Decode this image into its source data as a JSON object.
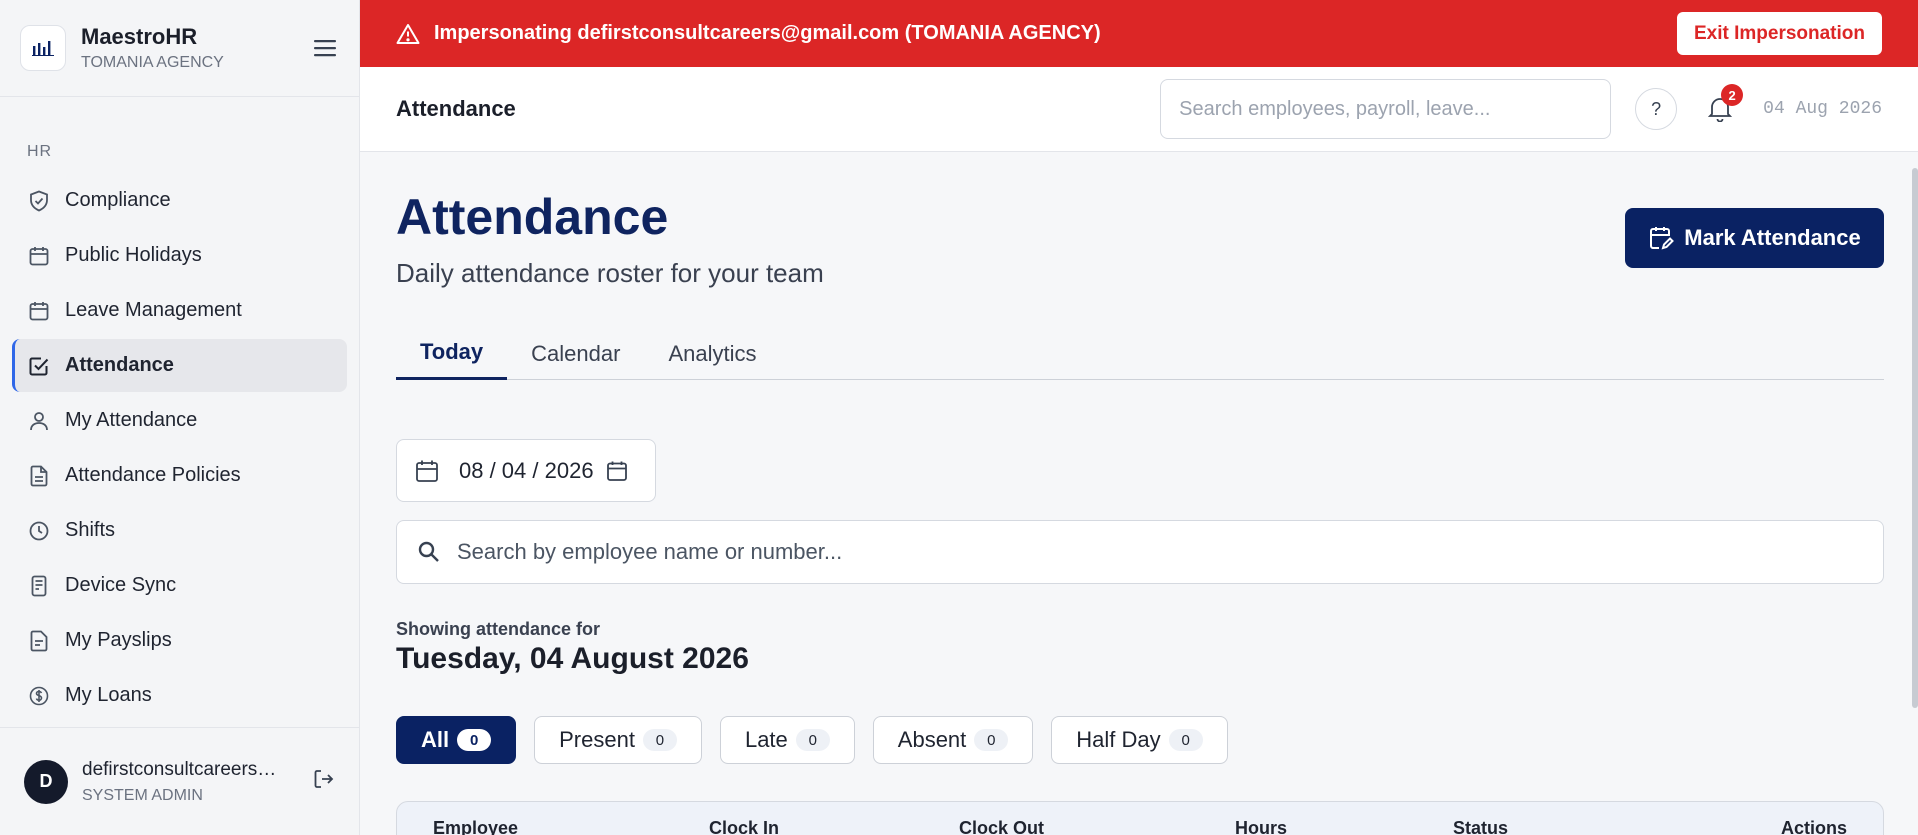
{
  "sidebar": {
    "brand_name": "MaestroHR",
    "brand_org": "TOMANIA AGENCY",
    "section_label": "HR",
    "items": [
      {
        "label": "Compliance",
        "icon": "shield-check-icon"
      },
      {
        "label": "Public Holidays",
        "icon": "calendar-icon"
      },
      {
        "label": "Leave Management",
        "icon": "calendar-icon"
      },
      {
        "label": "Attendance",
        "icon": "checkbox-icon",
        "active": true
      },
      {
        "label": "My Attendance",
        "icon": "user-icon"
      },
      {
        "label": "Attendance Policies",
        "icon": "document-icon"
      },
      {
        "label": "Shifts",
        "icon": "clock-icon"
      },
      {
        "label": "Device Sync",
        "icon": "device-icon"
      },
      {
        "label": "My Payslips",
        "icon": "receipt-icon"
      },
      {
        "label": "My Loans",
        "icon": "dollar-circle-icon"
      }
    ],
    "user": {
      "initial": "D",
      "email": "defirstconsultcareers@gmail.com",
      "role": "SYSTEM ADMIN"
    }
  },
  "banner": {
    "text": "Impersonating defirstconsultcareers@gmail.com (TOMANIA AGENCY)",
    "exit_label": "Exit Impersonation",
    "color": "#dc2626"
  },
  "header": {
    "title": "Attendance",
    "search_placeholder": "Search employees, payroll, leave...",
    "help_label": "?",
    "notification_count": "2",
    "date": "04 Aug 2026"
  },
  "main": {
    "title": "Attendance",
    "subtitle": "Daily attendance roster for your team",
    "mark_button": "Mark Attendance",
    "tabs": [
      {
        "label": "Today",
        "active": true
      },
      {
        "label": "Calendar"
      },
      {
        "label": "Analytics"
      }
    ],
    "date_value": "08 / 04 / 2026",
    "employee_search_placeholder": "Search by employee name or number...",
    "showing_label": "Showing attendance for",
    "showing_date": "Tuesday, 04 August 2026",
    "filters": [
      {
        "label": "All",
        "count": "0",
        "active": true
      },
      {
        "label": "Present",
        "count": "0"
      },
      {
        "label": "Late",
        "count": "0"
      },
      {
        "label": "Absent",
        "count": "0"
      },
      {
        "label": "Half Day",
        "count": "0"
      }
    ],
    "table_headers": [
      "Employee",
      "Clock In",
      "Clock Out",
      "Hours",
      "Status",
      "Actions"
    ]
  },
  "colors": {
    "primary": "#0a2263",
    "accent": "#2f67e8",
    "danger": "#dc2626"
  }
}
